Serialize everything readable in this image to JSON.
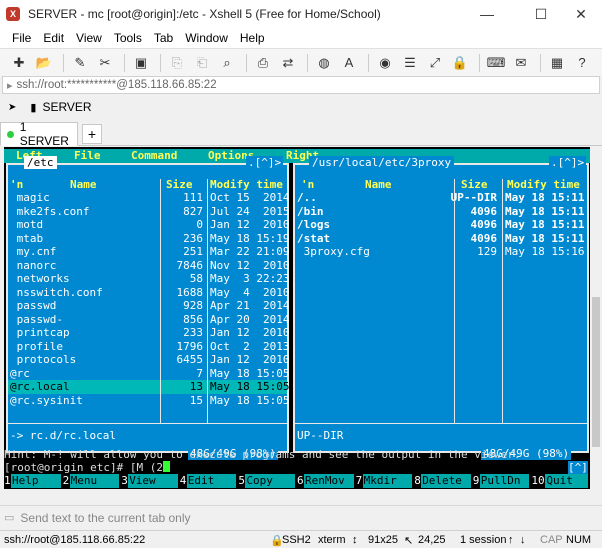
{
  "window": {
    "title": "SERVER - mc [root@origin]:/etc - Xshell 5 (Free for Home/School)",
    "minimize": "—",
    "maximize": "☐",
    "close": "✕"
  },
  "menu": [
    "File",
    "Edit",
    "View",
    "Tools",
    "Tab",
    "Window",
    "Help"
  ],
  "address": "ssh://root:***********@185.118.66.85:22",
  "session_button": "SERVER",
  "tab": {
    "label": "1 SERVER",
    "add": "+"
  },
  "mc": {
    "menubar": [
      "Left",
      "File",
      "Command",
      "Options",
      "Right"
    ],
    "left_panel": {
      "path": " /etc ",
      "marker": ".[^]>",
      "col_n": "'n",
      "col_name": "Name",
      "col_size": "Size",
      "col_modify": "Modify time",
      "rows": [
        {
          "name": " magic",
          "size": "111",
          "time": "Oct 15  2014"
        },
        {
          "name": " mke2fs.conf",
          "size": "827",
          "time": "Jul 24  2015"
        },
        {
          "name": " motd",
          "size": "0",
          "time": "Jan 12  2010"
        },
        {
          "name": " mtab",
          "size": "236",
          "time": "May 18 15:19"
        },
        {
          "name": " my.cnf",
          "size": "251",
          "time": "Mar 22 21:09"
        },
        {
          "name": " nanorc",
          "size": "7846",
          "time": "Nov 12  2010"
        },
        {
          "name": " networks",
          "size": "58",
          "time": "May  3 22:23"
        },
        {
          "name": " nsswitch.conf",
          "size": "1688",
          "time": "May  4  2010"
        },
        {
          "name": " passwd",
          "size": "928",
          "time": "Apr 21  2014"
        },
        {
          "name": " passwd-",
          "size": "856",
          "time": "Apr 20  2014"
        },
        {
          "name": " printcap",
          "size": "233",
          "time": "Jan 12  2010"
        },
        {
          "name": " profile",
          "size": "1796",
          "time": "Oct  2  2013"
        },
        {
          "name": " protocols",
          "size": "6455",
          "time": "Jan 12  2010"
        },
        {
          "name": "@rc",
          "size": "7",
          "time": "May 18 15:05"
        },
        {
          "name": "@rc.local",
          "size": "13",
          "time": "May 18 15:05"
        },
        {
          "name": "@rc.sysinit",
          "size": "15",
          "time": "May 18 15:05"
        }
      ],
      "info": "-> rc.d/rc.local",
      "footer": " 48G/49G (98%) "
    },
    "right_panel": {
      "path": " /usr/local/etc/3proxy ",
      "marker": ".[^]>",
      "col_n": "'n",
      "col_name": "Name",
      "col_size": "Size",
      "col_modify": "Modify time",
      "rows": [
        {
          "name": "/..",
          "size": "UP--DIR",
          "time": "May 18 15:11"
        },
        {
          "name": "/bin",
          "size": "4096",
          "time": "May 18 15:11"
        },
        {
          "name": "/logs",
          "size": "4096",
          "time": "May 18 15:11"
        },
        {
          "name": "/stat",
          "size": "4096",
          "time": "May 18 15:11"
        },
        {
          "name": " 3proxy.cfg",
          "size": "129",
          "time": "May 18 15:16"
        }
      ],
      "info": "UP--DIR",
      "footer": " 48G/49G (98%) "
    },
    "hint": "Hint: M-! will allow you to execute programs and see the output in the viewer.",
    "prompt": "[root@origin etc]# [M (2",
    "prompt_marker": "[^]",
    "fkeys": [
      {
        "n": "1",
        "l": "Help"
      },
      {
        "n": "2",
        "l": "Menu"
      },
      {
        "n": "3",
        "l": "View"
      },
      {
        "n": "4",
        "l": "Edit"
      },
      {
        "n": "5",
        "l": "Copy"
      },
      {
        "n": "6",
        "l": "RenMov"
      },
      {
        "n": "7",
        "l": "Mkdir"
      },
      {
        "n": "8",
        "l": "Delete"
      },
      {
        "n": "9",
        "l": "PullDn"
      },
      {
        "n": "10",
        "l": "Quit"
      }
    ]
  },
  "sendbar": "Send text to the current tab only",
  "status": {
    "conn": "ssh://root@185.118.66.85:22",
    "proto": "SSH2",
    "term": "xterm",
    "size": "91x25",
    "pos": "24,25",
    "sessions": "1 session",
    "cap": "CAP",
    "num": "NUM"
  }
}
